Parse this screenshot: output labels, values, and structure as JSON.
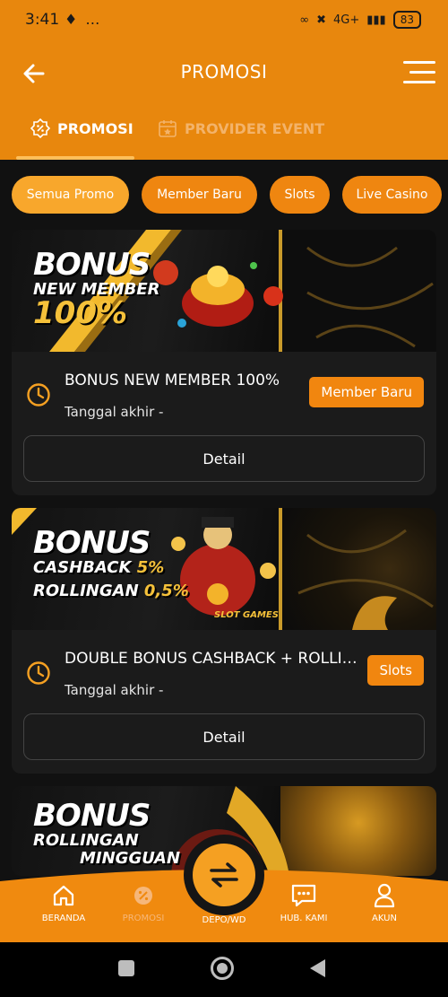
{
  "status": {
    "time": "3:41",
    "battery": "83",
    "network": "4G+"
  },
  "header": {
    "title": "PROMOSI"
  },
  "tabs": [
    {
      "label": "PROMOSI"
    },
    {
      "label": "PROVIDER EVENT"
    }
  ],
  "chips": [
    {
      "label": "Semua Promo"
    },
    {
      "label": "Member Baru"
    },
    {
      "label": "Slots"
    },
    {
      "label": "Live Casino"
    }
  ],
  "promos": [
    {
      "banner": {
        "line1": "BONUS",
        "line2": "NEW MEMBER",
        "line3": "100%"
      },
      "title": "BONUS NEW MEMBER 100%",
      "date_label": "Tanggal akhir -",
      "badge": "Member Baru",
      "detail_label": "Detail"
    },
    {
      "banner": {
        "line1": "BONUS",
        "line2": "CASHBACK",
        "line2b": "5%",
        "line3": "ROLLINGAN",
        "line3b": "0,5%",
        "brand": "SLOT GAMES"
      },
      "title": "DOUBLE BONUS CASHBACK + ROLLINGAN",
      "date_label": "Tanggal akhir -",
      "badge": "Slots",
      "detail_label": "Detail"
    },
    {
      "banner": {
        "line1": "BONUS",
        "line2": "ROLLINGAN",
        "line3": "MINGGUAN"
      }
    }
  ],
  "bottom_nav": [
    {
      "label": "BERANDA",
      "icon": "home-icon"
    },
    {
      "label": "PROMOSI",
      "icon": "percent-icon"
    },
    {
      "label": "DEPO/WD",
      "icon": "transfer-icon"
    },
    {
      "label": "HUB. KAMI",
      "icon": "chat-icon"
    },
    {
      "label": "AKUN",
      "icon": "user-icon"
    }
  ],
  "colors": {
    "primary": "#e8870d",
    "chip": "#ef8610",
    "chip_active": "#f8a72c",
    "card": "#1b1b1b",
    "accent_gold": "#f5c13a"
  }
}
